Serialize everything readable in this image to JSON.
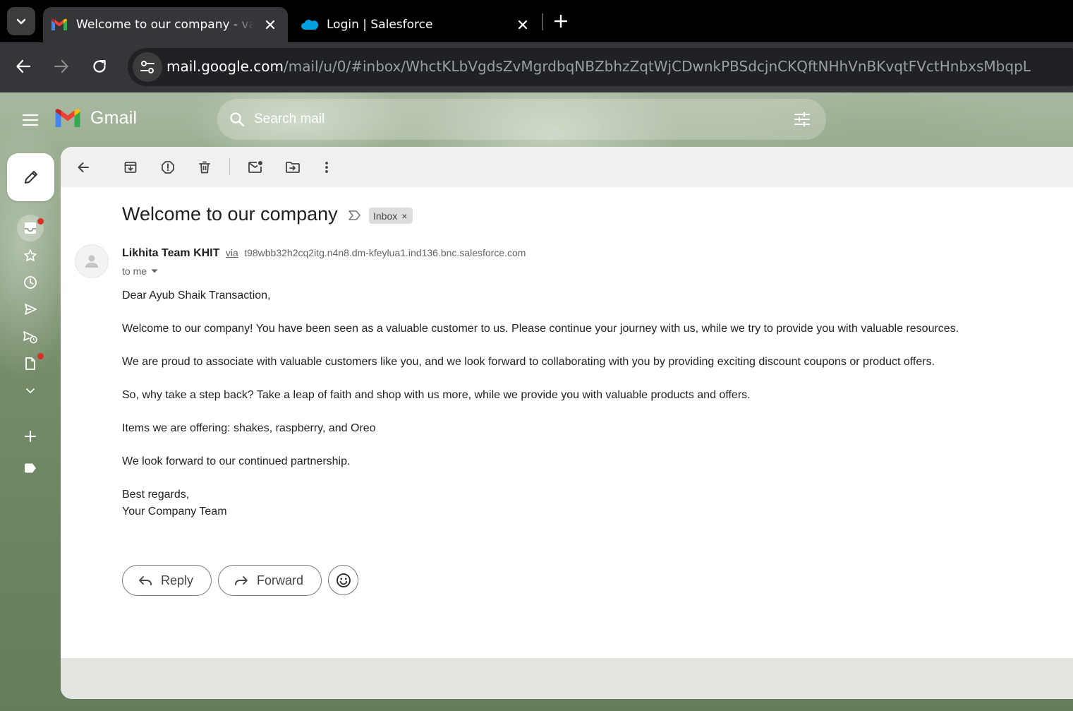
{
  "browser": {
    "tabs": [
      {
        "title": "Welcome to our company - vanshika",
        "favicon": "gmail-icon",
        "active": true
      },
      {
        "title": "Login | Salesforce",
        "favicon": "salesforce-cloud-icon",
        "active": false
      }
    ],
    "url_host": "mail.google.com",
    "url_path": "/mail/u/0/#inbox/WhctKLbVgdsZvMgrdbqNBZbhzZqtWjCDwnkPBSdcjnCKQftNHhVnBKvqtFVctHnbxsMbqpL"
  },
  "gmail": {
    "logo_text": "Gmail",
    "search_placeholder": "Search mail",
    "rail": [
      "inbox-icon",
      "star-icon",
      "clock-icon",
      "send-icon",
      "scheduled-send-icon",
      "draft-icon",
      "chevron-down-icon",
      "plus-icon",
      "label-icon"
    ],
    "toolbar_icons": [
      "back-arrow-icon",
      "archive-icon",
      "report-spam-icon",
      "delete-icon",
      "mark-unread-icon",
      "move-to-icon",
      "more-vert-icon"
    ]
  },
  "email": {
    "subject": "Welcome to our company",
    "label": "Inbox",
    "sender_name": "Likhita Team KHIT",
    "via": "via",
    "sender_domain": "t98wbb32h2cq2itg.n4n8.dm-kfeylua1.ind136.bnc.salesforce.com",
    "to": "to me",
    "body": {
      "greeting": "Dear Ayub Shaik Transaction,",
      "p1": "Welcome to our company! You have been seen as a valuable customer to us. Please continue your journey with us, while we try to provide you with valuable resources.",
      "p2": "We are proud to associate with valuable customers like you, and we look forward to collaborating with you by providing exciting discount coupons or product offers.",
      "p3": "So, why take a step back? Take a leap of faith and shop with us more, while we provide you with valuable products and offers.",
      "p4": "Items we are offering: shakes, raspberry, and Oreo",
      "p5": "We look forward to our continued partnership.",
      "closing": "Best regards,",
      "signature": "Your Company Team"
    },
    "reply_label": "Reply",
    "forward_label": "Forward"
  }
}
